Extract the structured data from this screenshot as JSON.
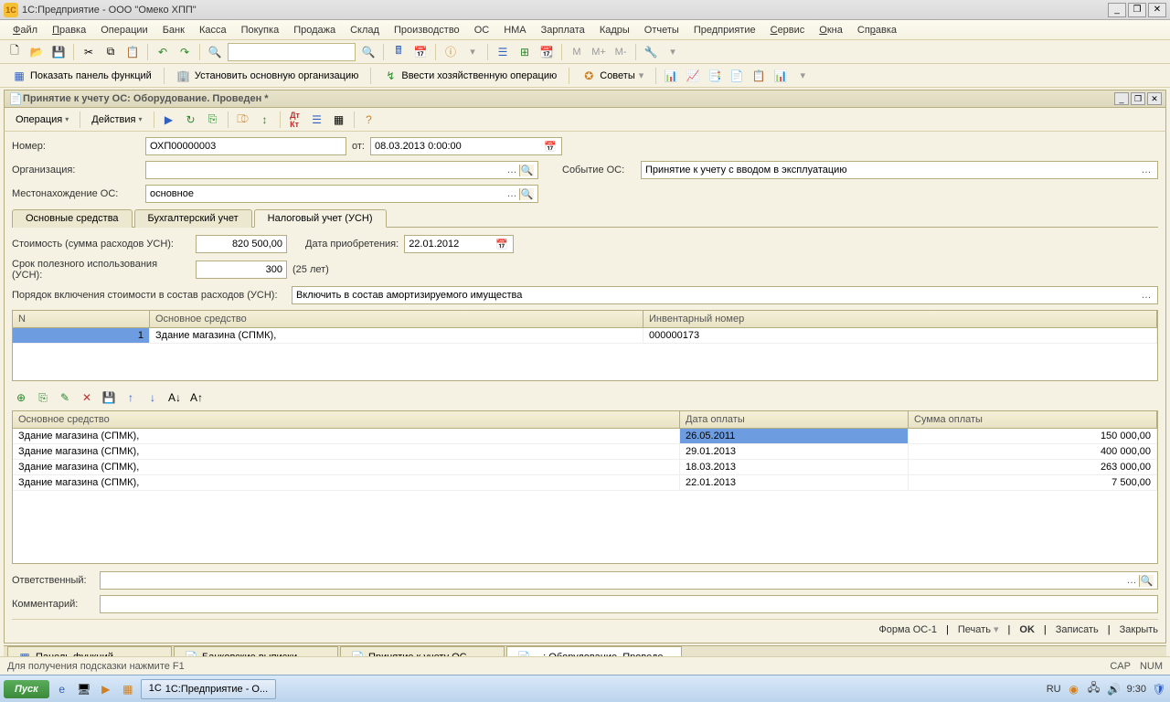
{
  "window_title": "1С:Предприятие - ООО \"Омеко ХПП\"",
  "menu": [
    "Файл",
    "Правка",
    "Операции",
    "Банк",
    "Касса",
    "Покупка",
    "Продажа",
    "Склад",
    "Производство",
    "ОС",
    "НМА",
    "Зарплата",
    "Кадры",
    "Отчеты",
    "Предприятие",
    "Сервис",
    "Окна",
    "Справка"
  ],
  "toolbar2": {
    "show_panel": "Показать панель функций",
    "set_org": "Установить основную организацию",
    "enter_op": "Ввести хозяйственную операцию",
    "tips": "Советы"
  },
  "doc_title": "Принятие к учету ОС: Оборудование. Проведен *",
  "doc_tb": {
    "operation": "Операция",
    "actions": "Действия"
  },
  "form": {
    "number_lbl": "Номер:",
    "number": "ОХП00000003",
    "from_lbl": "от:",
    "date": "08.03.2013  0:00:00",
    "org_lbl": "Организация:",
    "org": "",
    "event_lbl": "Событие ОС:",
    "event": "Принятие к учету с вводом в эксплуатацию",
    "loc_lbl": "Местонахождение ОС:",
    "loc": "основное",
    "tabs": [
      "Основные средства",
      "Бухгалтерский учет",
      "Налоговый учет (УСН)"
    ],
    "cost_lbl": "Стоимость (сумма расходов УСН):",
    "cost": "820 500,00",
    "acq_lbl": "Дата приобретения:",
    "acq": "22.01.2012",
    "life_lbl": "Срок полезного использования (УСН):",
    "life": "300",
    "life_note": "(25 лет)",
    "order_lbl": "Порядок включения стоимости в состав расходов (УСН):",
    "order": "Включить в состав амортизируемого имущества"
  },
  "grid1": {
    "headers": [
      "N",
      "Основное средство",
      "Инвентарный номер"
    ],
    "rows": [
      {
        "n": "1",
        "name": "Здание магазина  (СПМК),",
        "inv": "000000173"
      }
    ]
  },
  "grid2": {
    "headers": [
      "Основное средство",
      "Дата оплаты",
      "Сумма оплаты"
    ],
    "rows": [
      {
        "name": "Здание магазина  (СПМК),",
        "date": "26.05.2011",
        "sum": "150 000,00"
      },
      {
        "name": "Здание магазина  (СПМК),",
        "date": "29.01.2013",
        "sum": "400 000,00"
      },
      {
        "name": "Здание магазина  (СПМК),",
        "date": "18.03.2013",
        "sum": "263 000,00"
      },
      {
        "name": "Здание магазина  (СПМК),",
        "date": "22.01.2013",
        "sum": "7 500,00"
      }
    ]
  },
  "bottom": {
    "resp_lbl": "Ответственный:",
    "comment_lbl": "Комментарий:"
  },
  "footer": {
    "form": "Форма ОС-1",
    "print": "Печать",
    "ok": "OK",
    "save": "Записать",
    "close": "Закрыть"
  },
  "wintabs": [
    "Панель функций",
    "Банковские выписки",
    "Принятие к учету ОС",
    "...: Оборудование. Проведе..."
  ],
  "status": {
    "hint": "Для получения подсказки нажмите F1",
    "cap": "CAP",
    "num": "NUM"
  },
  "taskbar": {
    "start": "Пуск",
    "app": "1С:Предприятие - О...",
    "lang": "RU",
    "time": "9:30"
  }
}
